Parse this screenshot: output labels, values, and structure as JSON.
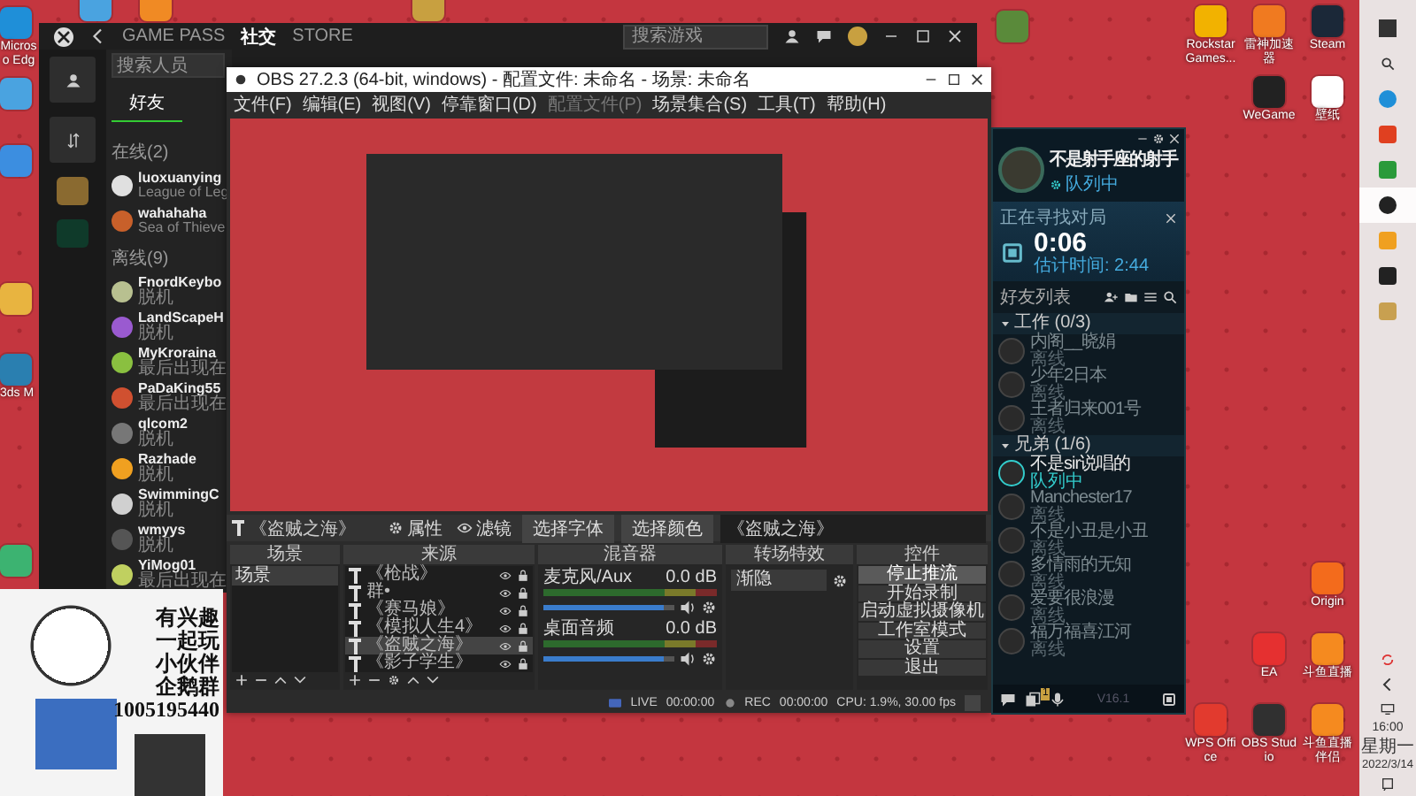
{
  "desktop_icons": [
    {
      "kind": "edge",
      "label": "Microso Edg"
    },
    {
      "kind": "doc"
    },
    {
      "kind": "map"
    },
    {
      "kind": "folder"
    },
    {
      "kind": "box3d",
      "label": "3ds M"
    },
    {
      "kind": "green"
    },
    {
      "kind": "doc"
    },
    {
      "kind": "orange"
    },
    {
      "kind": "pubg"
    },
    {
      "kind": "yicon"
    },
    {
      "kind": "rockstar",
      "label": "Rockstar Games..."
    },
    {
      "kind": "thunder",
      "label": "雷神加速器"
    },
    {
      "kind": "steam",
      "label": "Steam"
    },
    {
      "kind": "wegame",
      "label": "WeGame"
    },
    {
      "kind": "settings",
      "label": "壁纸"
    },
    {
      "kind": "origin",
      "label": "Origin"
    },
    {
      "kind": "ea",
      "label": "EA"
    },
    {
      "kind": "fish",
      "label": "斗鱼直播"
    },
    {
      "kind": "wps",
      "label": "WPS Office"
    },
    {
      "kind": "obs",
      "label": "OBS Studio"
    },
    {
      "kind": "fish",
      "label": "斗鱼直播伴侣"
    }
  ],
  "xbox": {
    "nav": [
      {
        "label": "GAME PASS",
        "selected": false
      },
      {
        "label": "社交",
        "selected": true
      },
      {
        "label": "STORE",
        "selected": false
      }
    ],
    "search": {
      "placeholder": "搜索游戏"
    },
    "people_search": {
      "placeholder": "搜索人员"
    },
    "tabs": [
      {
        "label": "好友",
        "selected": true
      }
    ],
    "sections": [
      {
        "title": "在线(2)",
        "friends": [
          {
            "name": "luoxuanying",
            "status": "League of Leg"
          },
          {
            "name": "wahahaha",
            "status": "Sea of Thieve"
          }
        ]
      },
      {
        "title": "离线(9)",
        "friends": [
          {
            "name": "FnordKeybo",
            "status": "脱机"
          },
          {
            "name": "LandScapeH",
            "status": "脱机"
          },
          {
            "name": "MyKroraina",
            "status": "最后出现在"
          },
          {
            "name": "PaDaKing55",
            "status": "最后出现在"
          },
          {
            "name": "qlcom2",
            "status": "脱机"
          },
          {
            "name": "Razhade",
            "status": "脱机"
          },
          {
            "name": "SwimmingC",
            "status": "脱机"
          },
          {
            "name": "wmyys",
            "status": "脱机"
          },
          {
            "name": "YiMog01",
            "status": "最后出现在"
          }
        ]
      }
    ]
  },
  "obs": {
    "title": "OBS 27.2.3 (64-bit, windows) - 配置文件: 未命名 - 场景: 未命名",
    "menu": [
      {
        "label": "文件(F)",
        "disabled": false
      },
      {
        "label": "编辑(E)",
        "disabled": false
      },
      {
        "label": "视图(V)",
        "disabled": false
      },
      {
        "label": "停靠窗口(D)",
        "disabled": false
      },
      {
        "label": "配置文件(P)",
        "disabled": true
      },
      {
        "label": "场景集合(S)",
        "disabled": false
      },
      {
        "label": "工具(T)",
        "disabled": false
      },
      {
        "label": "帮助(H)",
        "disabled": false
      }
    ],
    "source_toolbar": {
      "source": "《盗贼之海》",
      "buttons": [
        "属性",
        "滤镜"
      ],
      "actions": [
        "选择字体",
        "选择颜色"
      ],
      "text": "《盗贼之海》"
    },
    "dock_titles": [
      "场景",
      "来源",
      "混音器",
      "转场特效",
      "控件"
    ],
    "scenes": [
      {
        "name": "场景",
        "selected": true
      }
    ],
    "sources": [
      {
        "name": "《枪战》",
        "selected": false
      },
      {
        "name": "群•",
        "selected": false
      },
      {
        "name": "《赛马娘》",
        "selected": false
      },
      {
        "name": "《模拟人生4》",
        "selected": false
      },
      {
        "name": "《盗贼之海》",
        "selected": true
      },
      {
        "name": "《影子学生》",
        "selected": false
      }
    ],
    "mixer": [
      {
        "name": "麦克风/Aux",
        "reading": "0.0 dB",
        "level": 0.92
      },
      {
        "name": "桌面音频",
        "reading": "0.0 dB",
        "level": 0.92
      }
    ],
    "transition": "渐隐",
    "controls": [
      {
        "label": "停止推流",
        "selected": true
      },
      {
        "label": "开始录制",
        "selected": false
      },
      {
        "label": "启动虚拟摄像机",
        "selected": false
      },
      {
        "label": "工作室模式",
        "selected": false
      },
      {
        "label": "设置",
        "selected": false
      },
      {
        "label": "退出",
        "selected": false
      }
    ],
    "status": {
      "live": "LIVE",
      "live_time": "00:00:00",
      "rec": "REC",
      "rec_time": "00:00:00",
      "cpu": "CPU: 1.9%, 30.00 fps"
    }
  },
  "meme": {
    "lines": [
      "有兴趣",
      "一起玩",
      "小伙伴",
      "企鹅群",
      "1005195440"
    ]
  },
  "lol": {
    "name": "不是射手座的射手",
    "status": "队列中",
    "queue_title": "正在寻找对局",
    "timer": "0:06",
    "estimate": "估计时间: 2:44",
    "friends_title": "好友列表",
    "groups": [
      {
        "name": "工作 (0/3)",
        "expanded": true,
        "friends": [
          {
            "name": "内阁__晓娟",
            "status": "离线",
            "online": false
          },
          {
            "name": "少年2日本",
            "status": "离线",
            "online": false
          },
          {
            "name": "王者归来001号",
            "status": "离线",
            "online": false
          }
        ]
      },
      {
        "name": "兄弟 (1/6)",
        "expanded": true,
        "friends": [
          {
            "name": "不是sir说唱的",
            "status": "队列中",
            "online": true
          },
          {
            "name": "Manchester17",
            "status": "离线",
            "online": false
          },
          {
            "name": "不是小丑是小丑",
            "status": "离线",
            "online": false
          },
          {
            "name": "多情雨的无知",
            "status": "离线",
            "online": false
          },
          {
            "name": "爱要很浪漫",
            "status": "离线",
            "online": false
          },
          {
            "name": "福万福喜江河",
            "status": "离线",
            "online": false
          }
        ]
      }
    ],
    "badge": "1",
    "version": "V16.1"
  },
  "taskbar": {
    "apps": [
      {
        "kind": "windows",
        "selected": false
      },
      {
        "kind": "search",
        "selected": false
      },
      {
        "kind": "edge",
        "selected": false
      },
      {
        "kind": "office",
        "selected": false
      },
      {
        "kind": "xbox",
        "selected": false
      },
      {
        "kind": "obs",
        "selected": true
      },
      {
        "kind": "orange",
        "selected": false
      },
      {
        "kind": "gicon",
        "selected": false
      },
      {
        "kind": "lol",
        "selected": false
      }
    ],
    "time": "16:00",
    "day": "星期一",
    "date": "2022/3/14"
  }
}
